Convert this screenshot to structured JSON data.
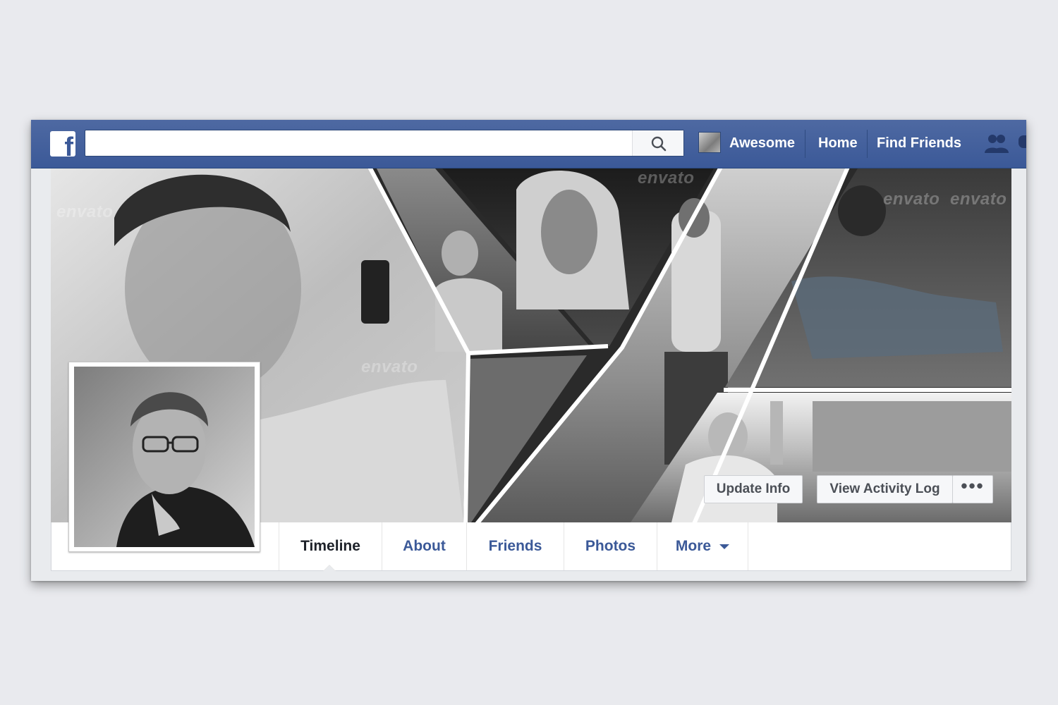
{
  "topbar": {
    "logo_letter": "f",
    "search": {
      "value": "",
      "placeholder": ""
    },
    "profile_name": "Awesome",
    "links": [
      "Home",
      "Find Friends"
    ]
  },
  "cover": {
    "watermark": "envato"
  },
  "actions": {
    "update_info": "Update Info",
    "activity_log": "View Activity Log",
    "more_dots": "•••"
  },
  "tabs": [
    {
      "label": "Timeline"
    },
    {
      "label": "About"
    },
    {
      "label": "Friends"
    },
    {
      "label": "Photos"
    },
    {
      "label": "More"
    }
  ],
  "colors": {
    "brand": "#3b5998",
    "topbar": "#3b5998",
    "tab_text": "#3b5998",
    "active_tab_text": "#1d2129",
    "background": "#e9ebee"
  },
  "icons": [
    "search-icon",
    "friend-requests-icon",
    "messages-icon",
    "chevron-down-icon"
  ]
}
